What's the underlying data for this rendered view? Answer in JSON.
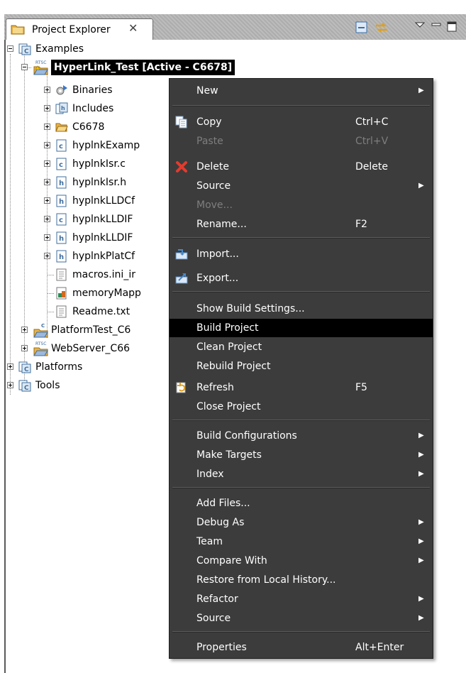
{
  "view": {
    "tab_label": "Project Explorer",
    "tab_close_glyph": "✕",
    "toolbar_icons": [
      "collapse-all-icon",
      "link-with-editor-icon",
      "view-menu-icon",
      "minimize-icon",
      "maximize-icon"
    ]
  },
  "tree": {
    "examples": "Examples",
    "rtsc_badge": "RTSC",
    "project": "HyperLink_Test  [Active - C6678]",
    "binaries": "Binaries",
    "includes": "Includes",
    "c6678": "C6678",
    "hyplnkExamp": "hyplnkExamp",
    "hyplnkIsr_c": "hyplnkIsr.c",
    "hyplnkIsr_h": "hyplnkIsr.h",
    "hyplnkLLDCf": "hyplnkLLDCf",
    "hyplnkLLDIF1": "hyplnkLLDIF",
    "hyplnkLLDIF2": "hyplnkLLDIF",
    "hyplnkPlatCf": "hyplnkPlatCf",
    "macros": "macros.ini_ir",
    "memoryMap": "memoryMapp",
    "readme": "Readme.txt",
    "platformTest": "PlatformTest_C6",
    "webServer": "WebServer_C66",
    "platforms": "Platforms",
    "tools": "Tools"
  },
  "context_menu": {
    "new": "New",
    "copy": "Copy",
    "copy_key": "Ctrl+C",
    "paste": "Paste",
    "paste_key": "Ctrl+V",
    "delete": "Delete",
    "delete_key": "Delete",
    "source": "Source",
    "move": "Move...",
    "rename": "Rename...",
    "rename_key": "F2",
    "import": "Import...",
    "export": "Export...",
    "show_build_settings": "Show Build Settings...",
    "build_project": "Build Project",
    "clean_project": "Clean Project",
    "rebuild_project": "Rebuild Project",
    "refresh": "Refresh",
    "refresh_key": "F5",
    "close_project": "Close Project",
    "build_configurations": "Build Configurations",
    "make_targets": "Make Targets",
    "index": "Index",
    "add_files": "Add Files...",
    "debug_as": "Debug As",
    "team": "Team",
    "compare_with": "Compare With",
    "restore_history": "Restore from Local History...",
    "refactor": "Refactor",
    "source2": "Source",
    "properties": "Properties",
    "properties_key": "Alt+Enter",
    "submenu_arrow": "▶"
  },
  "colors": {
    "menu_bg": "#3c3c3c",
    "menu_highlight": "#000000",
    "selection_bg": "#000000",
    "tab_strip": "#b4b4b4"
  }
}
